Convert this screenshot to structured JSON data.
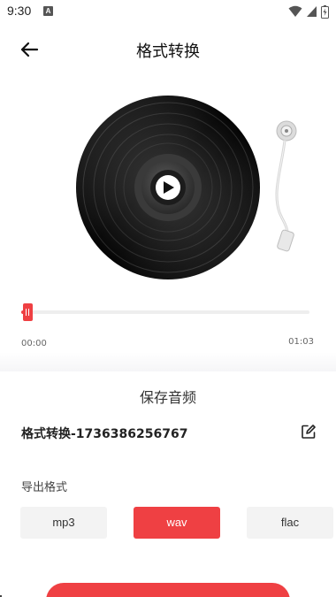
{
  "status_bar": {
    "time": "9:30",
    "notification_glyph": "A",
    "icons": [
      "wifi-icon",
      "signal-icon",
      "battery-icon"
    ]
  },
  "header": {
    "title": "格式转换",
    "back_icon": "arrow-left-icon"
  },
  "player": {
    "record_icon": "vinyl-record",
    "play_icon": "play-icon",
    "progress_percent": 2,
    "current_time": "00:00",
    "total_time": "01:03"
  },
  "save_panel": {
    "title": "保存音频",
    "file_name": "格式转换-1736386256767",
    "edit_icon": "edit-icon",
    "export_label": "导出格式",
    "formats": [
      "mp3",
      "wav",
      "flac"
    ],
    "selected_format": "wav"
  },
  "colors": {
    "accent": "#ef4043",
    "button_inactive": "#f3f3f3",
    "text": "#222222"
  }
}
